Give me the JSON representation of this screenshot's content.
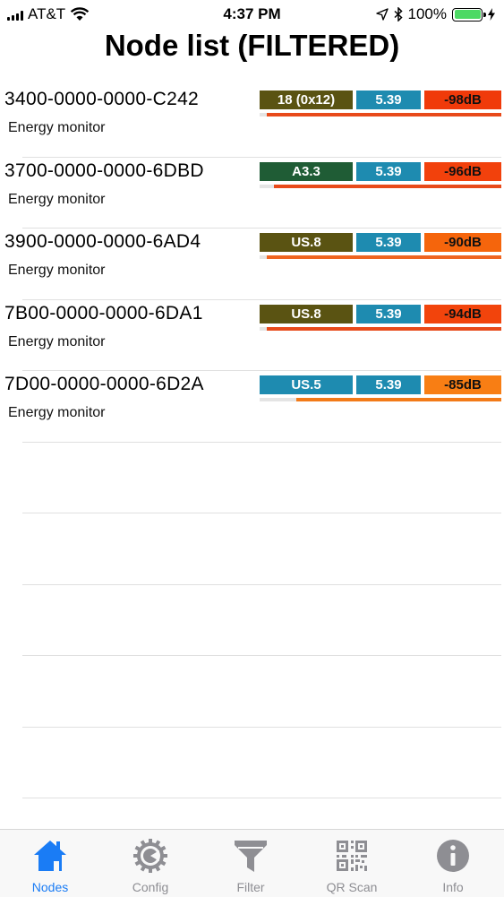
{
  "status_bar": {
    "carrier": "AT&T",
    "time": "4:37 PM",
    "battery": "100%",
    "battery_level": 1.0
  },
  "title": "Node list (FILTERED)",
  "nodes": [
    {
      "id": "3400-0000-0000-C242",
      "desc": "Energy monitor",
      "version": "18 (0x12)",
      "version_color": "#5a5312",
      "fw": "5.39",
      "rssi": "-98dB",
      "rssi_color": "#f03a0a",
      "signal_fraction": 0.97,
      "signal_color": "#e84a1a"
    },
    {
      "id": "3700-0000-0000-6DBD",
      "desc": "Energy monitor",
      "version": "A3.3",
      "version_color": "#1f5c35",
      "fw": "5.39",
      "rssi": "-96dB",
      "rssi_color": "#f2410c",
      "signal_fraction": 0.94,
      "signal_color": "#e84a1a"
    },
    {
      "id": "3900-0000-0000-6AD4",
      "desc": "Energy monitor",
      "version": "US.8",
      "version_color": "#5a5312",
      "fw": "5.39",
      "rssi": "-90dB",
      "rssi_color": "#f5650c",
      "signal_fraction": 0.97,
      "signal_color": "#ef6420"
    },
    {
      "id": "7B00-0000-0000-6DA1",
      "desc": "Energy monitor",
      "version": "US.8",
      "version_color": "#5a5312",
      "fw": "5.39",
      "rssi": "-94dB",
      "rssi_color": "#f2440c",
      "signal_fraction": 0.97,
      "signal_color": "#e84a1a"
    },
    {
      "id": "7D00-0000-0000-6D2A",
      "desc": "Energy monitor",
      "version": "US.5",
      "version_color": "#1e8bb0",
      "fw": "5.39",
      "rssi": "-85dB",
      "rssi_color": "#f87e14",
      "signal_fraction": 0.85,
      "signal_color": "#f27a18"
    }
  ],
  "tabs": [
    {
      "label": "Nodes",
      "icon": "house-icon",
      "active": true
    },
    {
      "label": "Config",
      "icon": "gear-icon",
      "active": false
    },
    {
      "label": "Filter",
      "icon": "funnel-icon",
      "active": false
    },
    {
      "label": "QR Scan",
      "icon": "qr-code-icon",
      "active": false
    },
    {
      "label": "Info",
      "icon": "info-icon",
      "active": false
    }
  ]
}
